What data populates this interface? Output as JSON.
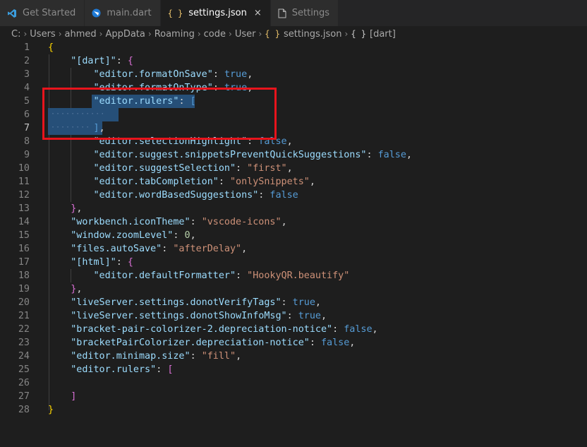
{
  "tabs": [
    {
      "label": "Get Started",
      "icon": "vscode-logo-icon",
      "active": false
    },
    {
      "label": "main.dart",
      "icon": "dart-file-icon",
      "active": false
    },
    {
      "label": "settings.json",
      "icon": "json-file-icon",
      "active": true
    },
    {
      "label": "Settings",
      "icon": "file-icon",
      "active": false
    }
  ],
  "tab_icons": {
    "json": "{ }",
    "close": "×"
  },
  "breadcrumb": {
    "items": [
      "C:",
      "Users",
      "ahmed",
      "AppData",
      "Roaming",
      "code",
      "User"
    ],
    "file_icon": "{ }",
    "file": "settings.json",
    "symbol_icon": "{ }",
    "symbol": "[dart]",
    "separator": "›"
  },
  "editor": {
    "line_numbers": [
      "1",
      "2",
      "3",
      "4",
      "5",
      "6",
      "7",
      "8",
      "9",
      "10",
      "11",
      "12",
      "13",
      "14",
      "15",
      "16",
      "17",
      "18",
      "19",
      "20",
      "21",
      "22",
      "23",
      "24",
      "25",
      "26",
      "27",
      "28"
    ],
    "lines": [
      [
        {
          "t": "{",
          "c": "y"
        }
      ],
      [
        {
          "t": "    "
        },
        {
          "t": "\"[dart]\"",
          "c": "k"
        },
        {
          "t": ": "
        },
        {
          "t": "{",
          "c": "m"
        }
      ],
      [
        {
          "t": "        "
        },
        {
          "t": "\"editor.formatOnSave\"",
          "c": "k"
        },
        {
          "t": ": "
        },
        {
          "t": "true",
          "c": "b"
        },
        {
          "t": ","
        }
      ],
      [
        {
          "t": "        "
        },
        {
          "t": "\"editor.formatOnType\"",
          "c": "k"
        },
        {
          "t": ": "
        },
        {
          "t": "true",
          "c": "b"
        },
        {
          "t": ","
        }
      ],
      [
        {
          "t": "        "
        },
        {
          "t": "\"editor.rulers\"",
          "c": "k"
        },
        {
          "t": ": "
        },
        {
          "t": "[",
          "c": "b"
        }
      ],
      [
        {
          "t": ""
        }
      ],
      [
        {
          "t": "        "
        },
        {
          "t": "]",
          "c": "b"
        },
        {
          "t": ","
        }
      ],
      [
        {
          "t": "        "
        },
        {
          "t": "\"editor.selectionHighlight\"",
          "c": "k"
        },
        {
          "t": ": "
        },
        {
          "t": "false",
          "c": "b"
        },
        {
          "t": ","
        }
      ],
      [
        {
          "t": "        "
        },
        {
          "t": "\"editor.suggest.snippetsPreventQuickSuggestions\"",
          "c": "k"
        },
        {
          "t": ": "
        },
        {
          "t": "false",
          "c": "b"
        },
        {
          "t": ","
        }
      ],
      [
        {
          "t": "        "
        },
        {
          "t": "\"editor.suggestSelection\"",
          "c": "k"
        },
        {
          "t": ": "
        },
        {
          "t": "\"first\"",
          "c": "s"
        },
        {
          "t": ","
        }
      ],
      [
        {
          "t": "        "
        },
        {
          "t": "\"editor.tabCompletion\"",
          "c": "k"
        },
        {
          "t": ": "
        },
        {
          "t": "\"onlySnippets\"",
          "c": "s"
        },
        {
          "t": ","
        }
      ],
      [
        {
          "t": "        "
        },
        {
          "t": "\"editor.wordBasedSuggestions\"",
          "c": "k"
        },
        {
          "t": ": "
        },
        {
          "t": "false",
          "c": "b"
        }
      ],
      [
        {
          "t": "    "
        },
        {
          "t": "}",
          "c": "m"
        },
        {
          "t": ","
        }
      ],
      [
        {
          "t": "    "
        },
        {
          "t": "\"workbench.iconTheme\"",
          "c": "k"
        },
        {
          "t": ": "
        },
        {
          "t": "\"vscode-icons\"",
          "c": "s"
        },
        {
          "t": ","
        }
      ],
      [
        {
          "t": "    "
        },
        {
          "t": "\"window.zoomLevel\"",
          "c": "k"
        },
        {
          "t": ": "
        },
        {
          "t": "0",
          "c": "n"
        },
        {
          "t": ","
        }
      ],
      [
        {
          "t": "    "
        },
        {
          "t": "\"files.autoSave\"",
          "c": "k"
        },
        {
          "t": ": "
        },
        {
          "t": "\"afterDelay\"",
          "c": "s"
        },
        {
          "t": ","
        }
      ],
      [
        {
          "t": "    "
        },
        {
          "t": "\"[html]\"",
          "c": "k"
        },
        {
          "t": ": "
        },
        {
          "t": "{",
          "c": "m"
        }
      ],
      [
        {
          "t": "        "
        },
        {
          "t": "\"editor.defaultFormatter\"",
          "c": "k"
        },
        {
          "t": ": "
        },
        {
          "t": "\"HookyQR.beautify\"",
          "c": "s"
        }
      ],
      [
        {
          "t": "    "
        },
        {
          "t": "}",
          "c": "m"
        },
        {
          "t": ","
        }
      ],
      [
        {
          "t": "    "
        },
        {
          "t": "\"liveServer.settings.donotVerifyTags\"",
          "c": "k"
        },
        {
          "t": ": "
        },
        {
          "t": "true",
          "c": "b"
        },
        {
          "t": ","
        }
      ],
      [
        {
          "t": "    "
        },
        {
          "t": "\"liveServer.settings.donotShowInfoMsg\"",
          "c": "k"
        },
        {
          "t": ": "
        },
        {
          "t": "true",
          "c": "b"
        },
        {
          "t": ","
        }
      ],
      [
        {
          "t": "    "
        },
        {
          "t": "\"bracket-pair-colorizer-2.depreciation-notice\"",
          "c": "k"
        },
        {
          "t": ": "
        },
        {
          "t": "false",
          "c": "b"
        },
        {
          "t": ","
        }
      ],
      [
        {
          "t": "    "
        },
        {
          "t": "\"bracketPairColorizer.depreciation-notice\"",
          "c": "k"
        },
        {
          "t": ": "
        },
        {
          "t": "false",
          "c": "b"
        },
        {
          "t": ","
        }
      ],
      [
        {
          "t": "    "
        },
        {
          "t": "\"editor.minimap.size\"",
          "c": "k"
        },
        {
          "t": ": "
        },
        {
          "t": "\"fill\"",
          "c": "s"
        },
        {
          "t": ","
        }
      ],
      [
        {
          "t": "    "
        },
        {
          "t": "\"editor.rulers\"",
          "c": "k"
        },
        {
          "t": ": "
        },
        {
          "t": "[",
          "c": "m"
        }
      ],
      [
        {
          "t": ""
        }
      ],
      [
        {
          "t": "    "
        },
        {
          "t": "]",
          "c": "m"
        }
      ],
      [
        {
          "t": "}",
          "c": "y"
        }
      ]
    ]
  },
  "colors": {
    "background": "#1e1e1e",
    "selection": "#264f78",
    "annotation_box": "#e8141c"
  }
}
